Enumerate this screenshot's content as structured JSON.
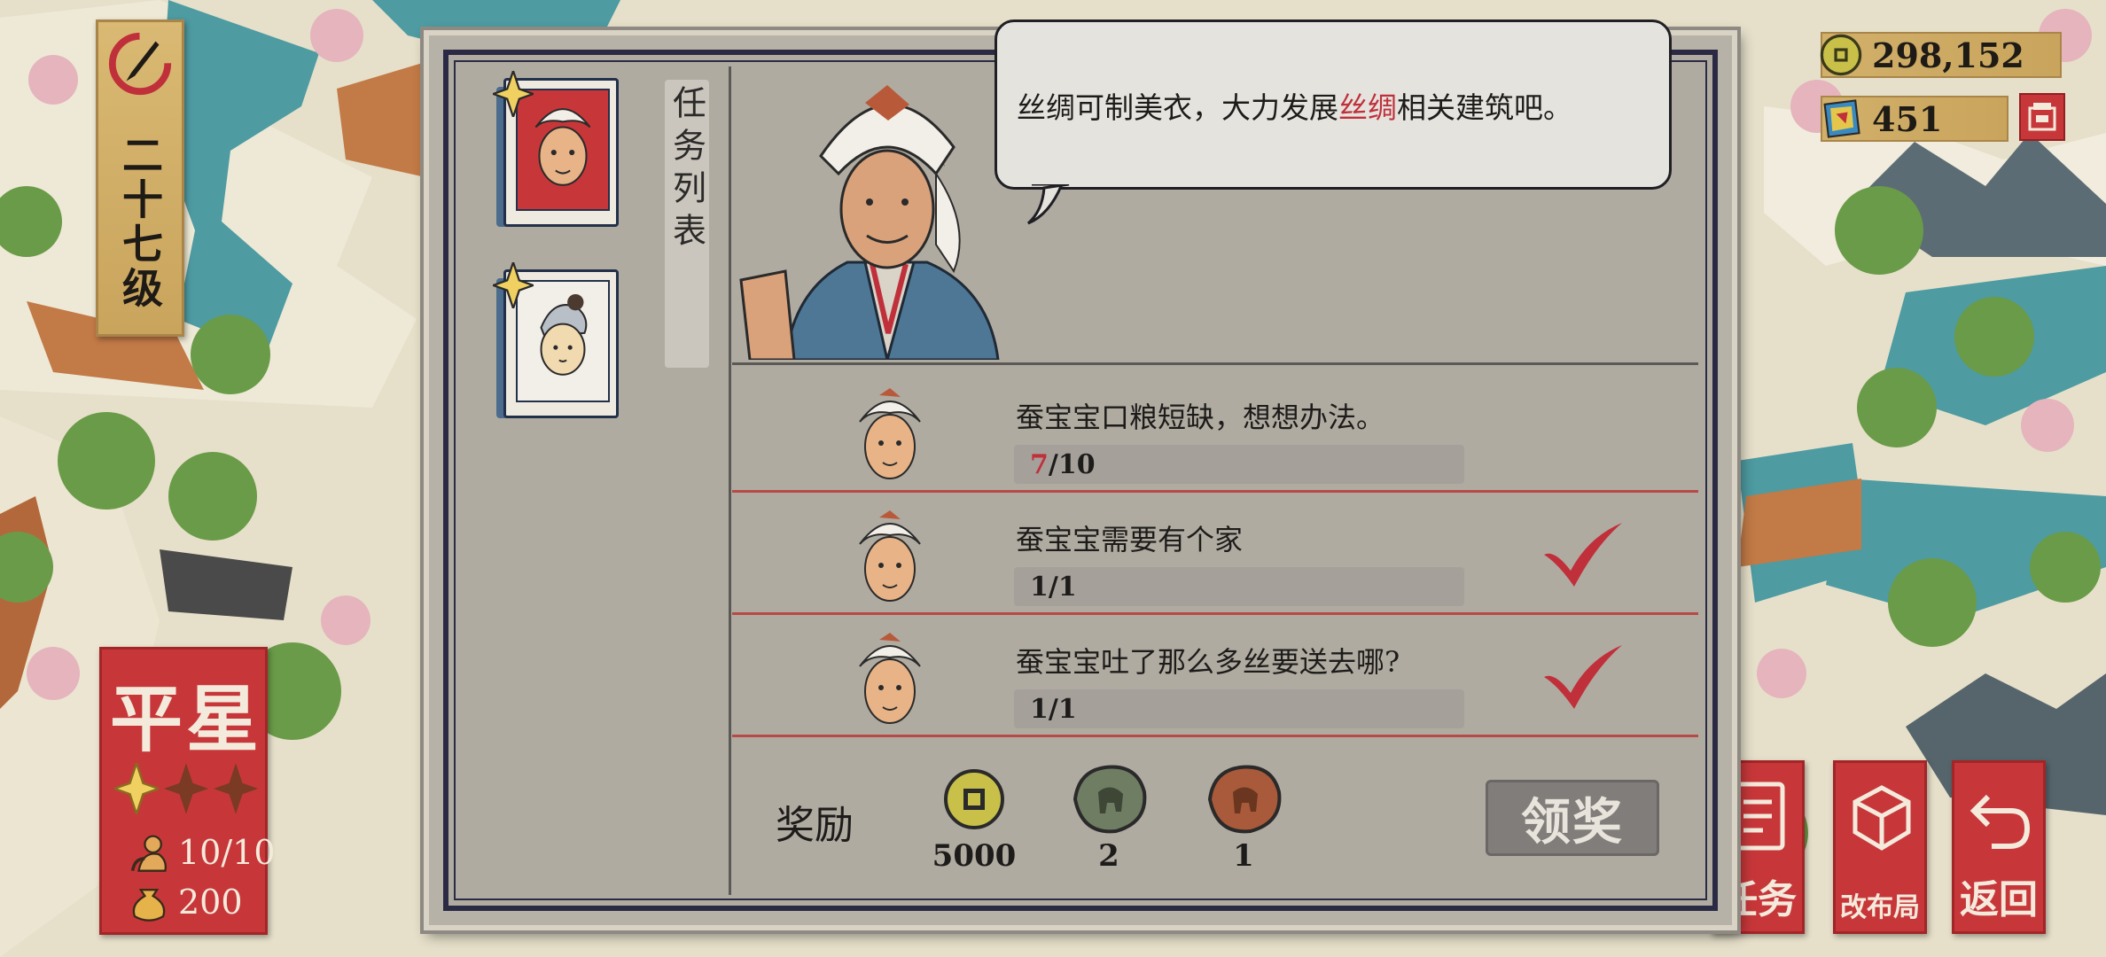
{
  "hud": {
    "level_label": "二十七级",
    "rank": {
      "title": "平星",
      "stars_filled": 1,
      "stars_total": 3,
      "population": "10/10",
      "food": "200"
    },
    "copper_coins": "298,152",
    "gems": "451",
    "buttons": {
      "tasks": "任务",
      "redesign": "改布局",
      "back": "返回"
    }
  },
  "panel": {
    "tab_label": "任务列表",
    "dialog": {
      "before": "丝绸可制美衣，大力发展",
      "highlight": "丝绸",
      "after": "相关建筑吧。"
    },
    "tasks": [
      {
        "title": "蚕宝宝口粮短缺，想想办法。",
        "progress_current": "7",
        "progress_total": "/10",
        "completed": false
      },
      {
        "title": "蚕宝宝需要有个家",
        "progress_current": "1",
        "progress_total": "/1",
        "completed": true
      },
      {
        "title": "蚕宝宝吐了那么多丝要送去哪?",
        "progress_current": "1",
        "progress_total": "/1",
        "completed": true
      }
    ],
    "reward_label": "奖励",
    "rewards": [
      {
        "icon": "copper-coin-icon",
        "count": "5000"
      },
      {
        "icon": "green-elephant-stone-icon",
        "count": "2"
      },
      {
        "icon": "brown-elephant-stone-icon",
        "count": "1"
      }
    ],
    "claim_label": "领奖"
  },
  "colors": {
    "accent_red": "#c7373a",
    "gold": "#c9a45c",
    "panel_gray": "#b0aba1",
    "highlight_red": "#c0303a"
  }
}
